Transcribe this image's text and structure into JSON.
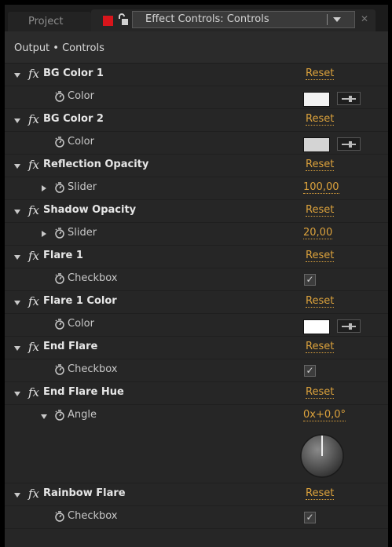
{
  "tabs": {
    "project": "Project",
    "effect_controls": "Effect Controls: Controls"
  },
  "breadcrumb": "Output • Controls",
  "rows": {
    "r0": {
      "name": "BG Color 1",
      "reset": "Reset"
    },
    "r1": {
      "label": "Color",
      "color": "#f2f2f2"
    },
    "r2": {
      "name": "BG Color 2",
      "reset": "Reset"
    },
    "r3": {
      "label": "Color",
      "color": "#d4d4d4"
    },
    "r4": {
      "name": "Reflection Opacity",
      "reset": "Reset"
    },
    "r5": {
      "label": "Slider",
      "value": "100,00"
    },
    "r6": {
      "name": "Shadow Opacity",
      "reset": "Reset"
    },
    "r7": {
      "label": "Slider",
      "value": "20,00"
    },
    "r8": {
      "name": "Flare 1",
      "reset": "Reset"
    },
    "r9": {
      "label": "Checkbox",
      "checked": true,
      "mark": "✓"
    },
    "r10": {
      "name": "Flare 1 Color",
      "reset": "Reset"
    },
    "r11": {
      "label": "Color",
      "color": "#ffffff"
    },
    "r12": {
      "name": "End Flare",
      "reset": "Reset"
    },
    "r13": {
      "label": "Checkbox",
      "checked": true,
      "mark": "✓"
    },
    "r14": {
      "name": "End Flare Hue",
      "reset": "Reset"
    },
    "r15": {
      "label": "Angle",
      "value": "0x+0,0°"
    },
    "r16": {
      "name": "Rainbow Flare",
      "reset": "Reset"
    },
    "r17": {
      "label": "Checkbox",
      "checked": true,
      "mark": "✓"
    }
  },
  "fx_symbol": "fx",
  "colors": {
    "accent": "#dca23c",
    "lock": "#d8151b",
    "panel_bg": "#262626"
  },
  "icons": {
    "stopwatch": "stopwatch-icon",
    "eyedropper": "eyedropper-icon",
    "angle_dial": "angle-dial-icon"
  }
}
